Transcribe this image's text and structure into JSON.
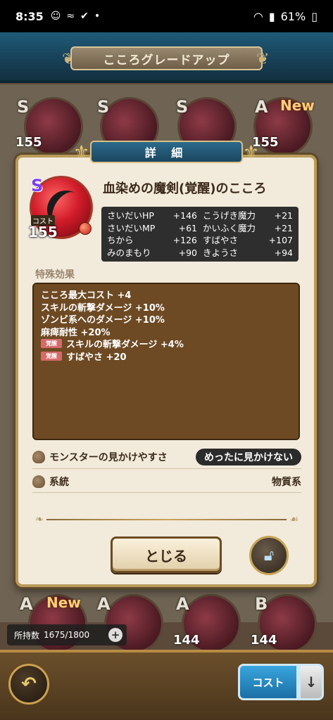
{
  "status_bar": {
    "time": "8:35",
    "icons": [
      "cat-icon",
      "vibrate-icon",
      "shield-icon",
      "dot-icon"
    ],
    "battery": "61%"
  },
  "header": {
    "title": "こころグレードアップ"
  },
  "background_tiles": [
    {
      "rank": "S",
      "cost": "155",
      "new": ""
    },
    {
      "rank": "S",
      "cost": "",
      "new": ""
    },
    {
      "rank": "S",
      "cost": "",
      "new": ""
    },
    {
      "rank": "A",
      "cost": "155",
      "new": "New"
    },
    {
      "rank": "A",
      "cost": "",
      "new": "New"
    },
    {
      "rank": "A",
      "cost": "",
      "new": ""
    },
    {
      "rank": "A",
      "cost": "144",
      "new": ""
    },
    {
      "rank": "B",
      "cost": "144",
      "new": ""
    }
  ],
  "dialog": {
    "title": "詳 細",
    "heart": {
      "name": "血染めの魔剣(覚醒)のこころ",
      "rank": "S",
      "cost_label": "コスト",
      "cost": "155"
    },
    "stats": [
      {
        "label": "さいだいHP",
        "value": "+146"
      },
      {
        "label": "こうげき魔力",
        "value": "+21"
      },
      {
        "label": "さいだいMP",
        "value": "+61"
      },
      {
        "label": "かいふく魔力",
        "value": "+21"
      },
      {
        "label": "ちから",
        "value": "+126"
      },
      {
        "label": "すばやさ",
        "value": "+107"
      },
      {
        "label": "みのまもり",
        "value": "+90"
      },
      {
        "label": "きようさ",
        "value": "+94"
      }
    ],
    "special_title": "特殊効果",
    "special_effects": [
      {
        "badge": "",
        "text": "こころ最大コスト +4"
      },
      {
        "badge": "",
        "text": "スキルの斬撃ダメージ +10%"
      },
      {
        "badge": "",
        "text": "ゾンビ系へのダメージ +10%"
      },
      {
        "badge": "",
        "text": "麻痺耐性 +20%"
      },
      {
        "badge": "覚醒",
        "text": "スキルの斬撃ダメージ +4%"
      },
      {
        "badge": "覚醒",
        "text": "すばやさ +20"
      }
    ],
    "visibility_label": "モンスターの見かけやすさ",
    "visibility_value": "めったに見かけない",
    "family_label": "系統",
    "family_value": "物質系",
    "close_button": "とじる"
  },
  "footer": {
    "owned_label": "所持数",
    "owned_value": "1675/1800",
    "cost_button": "コスト",
    "sort_icon": "arrow-down-icon"
  },
  "colors": {
    "header_band": "#1f5b78",
    "dialog_bg": "#f2eadb",
    "special_box": "#6d4a23",
    "cost_button": "#2a8fcb"
  }
}
